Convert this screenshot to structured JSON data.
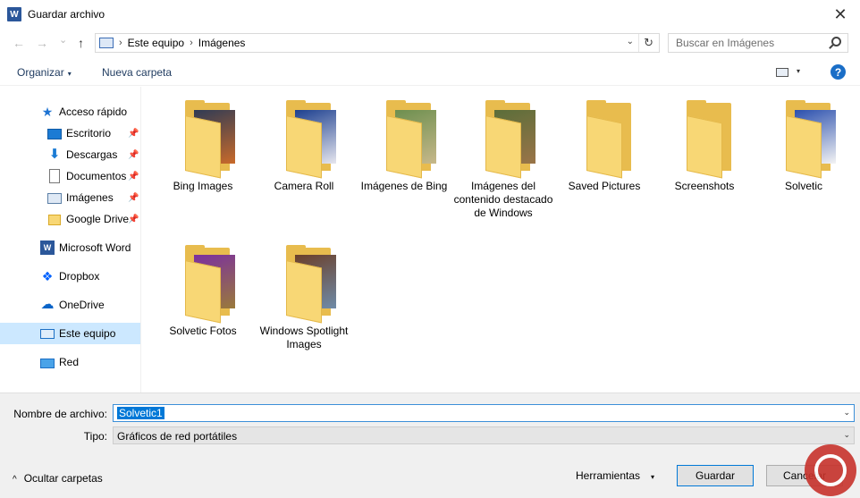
{
  "window": {
    "title": "Guardar archivo",
    "app_icon_letter": "W",
    "close_glyph": "✕"
  },
  "navigation": {
    "back_glyph": "←",
    "forward_glyph": "→",
    "history_glyph": "⌄",
    "up_glyph": "↑",
    "breadcrumbs": [
      "Este equipo",
      "Imágenes"
    ],
    "separator": "›",
    "dropdown_glyph": "⌄",
    "refresh_glyph": "↻",
    "search_placeholder": "Buscar en Imágenes"
  },
  "toolbar": {
    "organize_label": "Organizar",
    "new_folder_label": "Nueva carpeta",
    "caret_glyph": "▾",
    "help_glyph": "?"
  },
  "sidebar": {
    "items": [
      {
        "label": "Acceso rápido",
        "icon": "quick-access-icon",
        "glyph": "★",
        "pinned": false
      },
      {
        "label": "Escritorio",
        "icon": "desktop-icon",
        "glyph": "",
        "pinned": true
      },
      {
        "label": "Descargas",
        "icon": "download-icon",
        "glyph": "⬇",
        "pinned": true
      },
      {
        "label": "Documentos",
        "icon": "document-icon",
        "glyph": "",
        "pinned": true
      },
      {
        "label": "Imágenes",
        "icon": "pictures-icon",
        "glyph": "",
        "pinned": true
      },
      {
        "label": "Google Drive",
        "icon": "folder-icon",
        "glyph": "",
        "pinned": true
      },
      {
        "label": "Microsoft Word",
        "icon": "word-icon",
        "glyph": "W",
        "pinned": false
      },
      {
        "label": "Dropbox",
        "icon": "dropbox-icon",
        "glyph": "❖",
        "pinned": false
      },
      {
        "label": "OneDrive",
        "icon": "onedrive-icon",
        "glyph": "☁",
        "pinned": false
      },
      {
        "label": "Este equipo",
        "icon": "this-pc-icon",
        "glyph": "",
        "pinned": false,
        "selected": true
      },
      {
        "label": "Red",
        "icon": "network-icon",
        "glyph": "",
        "pinned": false
      }
    ],
    "pin_glyph": "📌"
  },
  "folders": [
    {
      "label": "Bing Images",
      "photo": [
        "#2f3b55",
        "#c96a2a"
      ]
    },
    {
      "label": "Camera Roll",
      "photo": [
        "#1c3f8f",
        "#e6e6ee"
      ]
    },
    {
      "label": "Imágenes de Bing",
      "photo": [
        "#6d8f4f",
        "#c7b88a"
      ]
    },
    {
      "label": "Imágenes del contenido destacado de Windows",
      "photo": [
        "#5b6e3a",
        "#9a7448"
      ]
    },
    {
      "label": "Saved Pictures",
      "photo": null
    },
    {
      "label": "Screenshots",
      "photo": null
    },
    {
      "label": "Solvetic",
      "photo": [
        "#2a4fae",
        "#f3f3f3"
      ]
    },
    {
      "label": "Solvetic Fotos",
      "photo": [
        "#7b2fa0",
        "#9a7a3a"
      ]
    },
    {
      "label": "Windows Spotlight Images",
      "photo": [
        "#6b3f2a",
        "#6f8ba8"
      ]
    }
  ],
  "footer": {
    "filename_label": "Nombre de archivo:",
    "filename_value": "Solvetic1",
    "type_label": "Tipo:",
    "type_value": "Gráficos de red portátiles",
    "hide_folders_label": "Ocultar carpetas",
    "hide_caret": "^",
    "tools_label": "Herramientas",
    "save_label": "Guardar",
    "cancel_label": "Cancelar",
    "combo_caret": "⌄"
  },
  "colors": {
    "accent": "#0078d7",
    "selection": "#cce8ff",
    "folder_yellow": "#f8d775"
  }
}
